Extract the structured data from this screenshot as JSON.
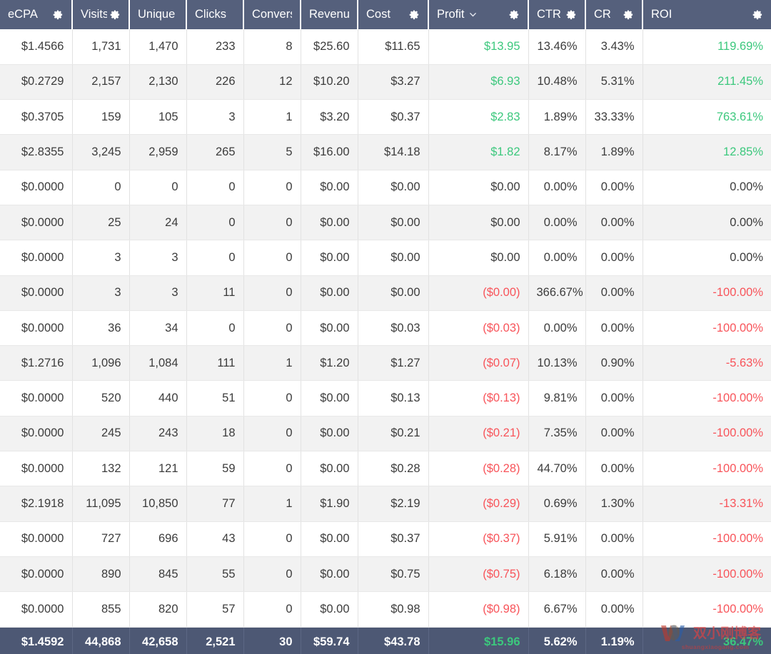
{
  "table": {
    "columns": [
      {
        "label": "eCPA",
        "gear": true,
        "sort": false,
        "truncated": false,
        "align": "right"
      },
      {
        "label": "Visits",
        "gear": true,
        "sort": false,
        "truncated": true,
        "align": "right"
      },
      {
        "label": "Unique vi",
        "gear": false,
        "sort": false,
        "truncated": true,
        "align": "right"
      },
      {
        "label": "Clicks",
        "gear": false,
        "sort": false,
        "truncated": false,
        "align": "right"
      },
      {
        "label": "Convers",
        "gear": false,
        "sort": false,
        "truncated": true,
        "align": "right"
      },
      {
        "label": "Revenue",
        "gear": false,
        "sort": false,
        "truncated": false,
        "align": "right"
      },
      {
        "label": "Cost",
        "gear": true,
        "sort": false,
        "truncated": false,
        "align": "right"
      },
      {
        "label": "Profit",
        "gear": true,
        "sort": true,
        "truncated": false,
        "align": "right"
      },
      {
        "label": "CTR",
        "gear": true,
        "sort": false,
        "truncated": false,
        "align": "right"
      },
      {
        "label": "CR",
        "gear": true,
        "sort": false,
        "truncated": false,
        "align": "right"
      },
      {
        "label": "ROI",
        "gear": true,
        "sort": false,
        "truncated": false,
        "align": "right"
      }
    ],
    "rows": [
      {
        "cells": [
          "$1.4566",
          "1,731",
          "1,470",
          "233",
          "8",
          "$25.60",
          "$11.65",
          "$13.95",
          "13.46%",
          "3.43%",
          "119.69%"
        ],
        "profit_sign": "pos",
        "roi_sign": "pos"
      },
      {
        "cells": [
          "$0.2729",
          "2,157",
          "2,130",
          "226",
          "12",
          "$10.20",
          "$3.27",
          "$6.93",
          "10.48%",
          "5.31%",
          "211.45%"
        ],
        "profit_sign": "pos",
        "roi_sign": "pos"
      },
      {
        "cells": [
          "$0.3705",
          "159",
          "105",
          "3",
          "1",
          "$3.20",
          "$0.37",
          "$2.83",
          "1.89%",
          "33.33%",
          "763.61%"
        ],
        "profit_sign": "pos",
        "roi_sign": "pos"
      },
      {
        "cells": [
          "$2.8355",
          "3,245",
          "2,959",
          "265",
          "5",
          "$16.00",
          "$14.18",
          "$1.82",
          "8.17%",
          "1.89%",
          "12.85%"
        ],
        "profit_sign": "pos",
        "roi_sign": "pos"
      },
      {
        "cells": [
          "$0.0000",
          "0",
          "0",
          "0",
          "0",
          "$0.00",
          "$0.00",
          "$0.00",
          "0.00%",
          "0.00%",
          "0.00%"
        ],
        "profit_sign": "neutral",
        "roi_sign": "neutral"
      },
      {
        "cells": [
          "$0.0000",
          "25",
          "24",
          "0",
          "0",
          "$0.00",
          "$0.00",
          "$0.00",
          "0.00%",
          "0.00%",
          "0.00%"
        ],
        "profit_sign": "neutral",
        "roi_sign": "neutral"
      },
      {
        "cells": [
          "$0.0000",
          "3",
          "3",
          "0",
          "0",
          "$0.00",
          "$0.00",
          "$0.00",
          "0.00%",
          "0.00%",
          "0.00%"
        ],
        "profit_sign": "neutral",
        "roi_sign": "neutral"
      },
      {
        "cells": [
          "$0.0000",
          "3",
          "3",
          "11",
          "0",
          "$0.00",
          "$0.00",
          "($0.00)",
          "366.67%",
          "0.00%",
          "-100.00%"
        ],
        "profit_sign": "neg",
        "roi_sign": "neg"
      },
      {
        "cells": [
          "$0.0000",
          "36",
          "34",
          "0",
          "0",
          "$0.00",
          "$0.03",
          "($0.03)",
          "0.00%",
          "0.00%",
          "-100.00%"
        ],
        "profit_sign": "neg",
        "roi_sign": "neg"
      },
      {
        "cells": [
          "$1.2716",
          "1,096",
          "1,084",
          "111",
          "1",
          "$1.20",
          "$1.27",
          "($0.07)",
          "10.13%",
          "0.90%",
          "-5.63%"
        ],
        "profit_sign": "neg",
        "roi_sign": "neg"
      },
      {
        "cells": [
          "$0.0000",
          "520",
          "440",
          "51",
          "0",
          "$0.00",
          "$0.13",
          "($0.13)",
          "9.81%",
          "0.00%",
          "-100.00%"
        ],
        "profit_sign": "neg",
        "roi_sign": "neg"
      },
      {
        "cells": [
          "$0.0000",
          "245",
          "243",
          "18",
          "0",
          "$0.00",
          "$0.21",
          "($0.21)",
          "7.35%",
          "0.00%",
          "-100.00%"
        ],
        "profit_sign": "neg",
        "roi_sign": "neg"
      },
      {
        "cells": [
          "$0.0000",
          "132",
          "121",
          "59",
          "0",
          "$0.00",
          "$0.28",
          "($0.28)",
          "44.70%",
          "0.00%",
          "-100.00%"
        ],
        "profit_sign": "neg",
        "roi_sign": "neg"
      },
      {
        "cells": [
          "$2.1918",
          "11,095",
          "10,850",
          "77",
          "1",
          "$1.90",
          "$2.19",
          "($0.29)",
          "0.69%",
          "1.30%",
          "-13.31%"
        ],
        "profit_sign": "neg",
        "roi_sign": "neg"
      },
      {
        "cells": [
          "$0.0000",
          "727",
          "696",
          "43",
          "0",
          "$0.00",
          "$0.37",
          "($0.37)",
          "5.91%",
          "0.00%",
          "-100.00%"
        ],
        "profit_sign": "neg",
        "roi_sign": "neg"
      },
      {
        "cells": [
          "$0.0000",
          "890",
          "845",
          "55",
          "0",
          "$0.00",
          "$0.75",
          "($0.75)",
          "6.18%",
          "0.00%",
          "-100.00%"
        ],
        "profit_sign": "neg",
        "roi_sign": "neg"
      },
      {
        "cells": [
          "$0.0000",
          "855",
          "820",
          "57",
          "0",
          "$0.00",
          "$0.98",
          "($0.98)",
          "6.67%",
          "0.00%",
          "-100.00%"
        ],
        "profit_sign": "neg",
        "roi_sign": "neg"
      }
    ],
    "totals": {
      "cells": [
        "$1.4592",
        "44,868",
        "42,658",
        "2,521",
        "30",
        "$59.74",
        "$43.78",
        "$15.96",
        "5.62%",
        "1.19%",
        "36.47%"
      ],
      "profit_sign": "pos",
      "roi_sign": "pos"
    }
  },
  "watermark": {
    "text_cn": "双小刚博客",
    "url": "shuangxiaogang.com"
  },
  "colors": {
    "header_bg": "#55607c",
    "total_bg": "#4d5874",
    "positive": "#3cc87d",
    "negative": "#f8545a",
    "text": "#3c3c3c",
    "stripe": "#f2f2f2"
  },
  "icons": {
    "gear": "gear-icon",
    "sort": "chevron-down-icon"
  }
}
